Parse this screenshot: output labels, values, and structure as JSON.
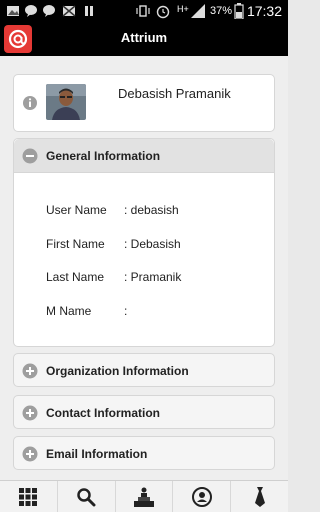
{
  "status_bar": {
    "network": "H+",
    "battery": "37%",
    "time": "17:32"
  },
  "app_bar": {
    "title": "Attrium",
    "logo_icon": "at-sign-icon",
    "logo_color": "#e53935"
  },
  "profile": {
    "name": "Debasish Pramanik"
  },
  "sections": {
    "general": {
      "title": "General Information",
      "expanded": true,
      "fields": [
        {
          "label": "User Name",
          "value": ": debasish"
        },
        {
          "label": "First Name",
          "value": ": Debasish"
        },
        {
          "label": "Last Name",
          "value": ": Pramanik"
        },
        {
          "label": "M Name",
          "value": ":"
        }
      ]
    },
    "organization": {
      "title": "Organization Information",
      "expanded": false
    },
    "contact": {
      "title": "Contact Information",
      "expanded": false
    },
    "email": {
      "title": "Email Information",
      "expanded": false
    }
  },
  "bottom_nav": [
    "grid-icon",
    "search-icon",
    "podium-icon",
    "contact-card-icon",
    "tie-icon"
  ]
}
